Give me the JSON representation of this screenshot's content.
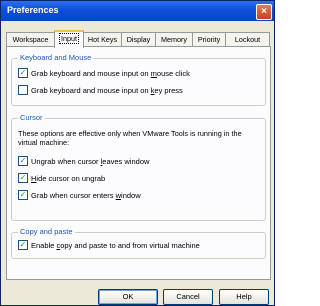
{
  "window": {
    "title": "Preferences",
    "close_glyph": "×"
  },
  "tabs": [
    "Workspace",
    "Input",
    "Hot Keys",
    "Display",
    "Memory",
    "Priority",
    "Lockout"
  ],
  "keyboard_mouse": {
    "title": "Keyboard and Mouse",
    "items": [
      {
        "pre": "Grab keyboard and mouse input on ",
        "key": "m",
        "post": "ouse click",
        "checked": true
      },
      {
        "pre": "Grab keyboard and mouse input on ",
        "key": "k",
        "post": "ey press",
        "checked": false
      }
    ]
  },
  "cursor": {
    "title": "Cursor",
    "description": "These options are effective only when VMware Tools is running in the virtual machine:",
    "items": [
      {
        "pre": "Ungrab when cursor ",
        "key": "l",
        "post": "eaves window",
        "checked": true
      },
      {
        "pre": "",
        "key": "H",
        "post": "ide cursor on ungrab",
        "checked": true
      },
      {
        "pre": "Grab when cursor enters ",
        "key": "w",
        "post": "indow",
        "checked": true
      }
    ]
  },
  "copy_paste": {
    "title": "Copy and paste",
    "items": [
      {
        "pre": "Enable ",
        "key": "c",
        "post": "opy and paste to and from virtual machine",
        "checked": true
      }
    ]
  },
  "buttons": {
    "ok": "OK",
    "cancel": "Cancel",
    "help": "Help"
  },
  "check_glyph": "✓"
}
